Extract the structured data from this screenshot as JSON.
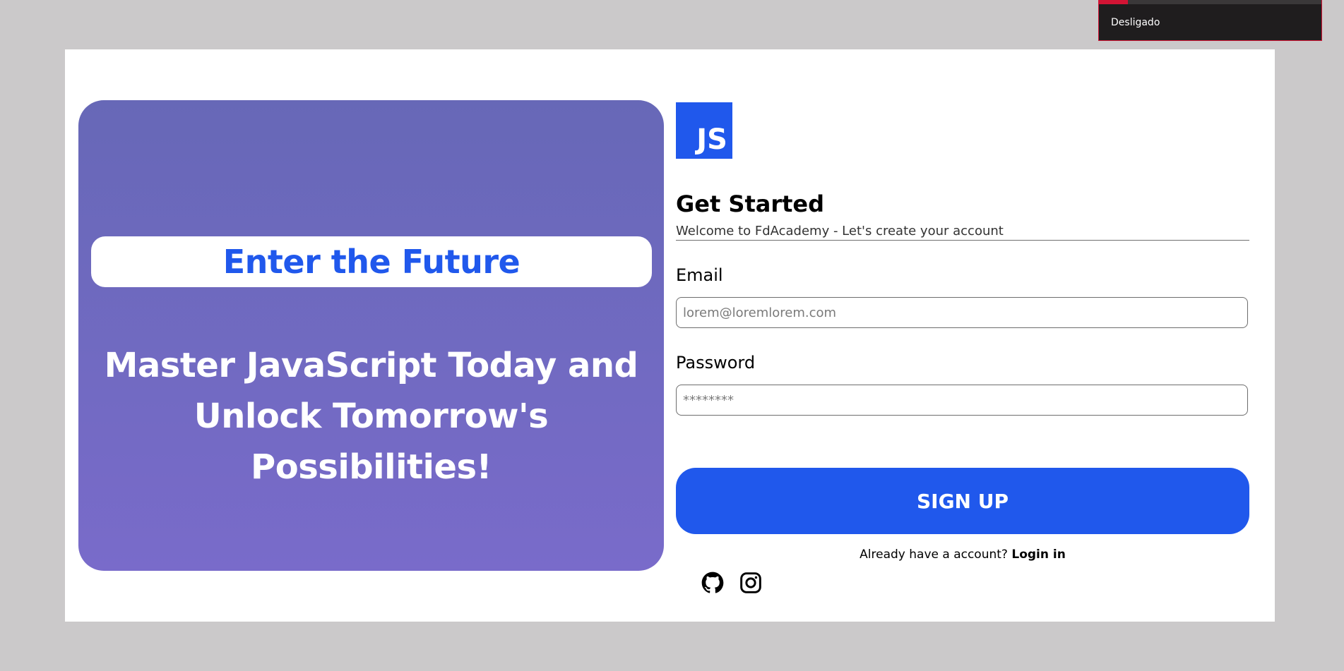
{
  "colors": {
    "backdrop": "#cbc9ca",
    "accent": "#2058ec",
    "hero_top": "#6768b7",
    "hero_bottom": "#796bca",
    "notification_bg": "#1f1d1e",
    "notification_accent": "#d21434"
  },
  "notification": {
    "text": "Desligado",
    "progress": 0.13
  },
  "hero": {
    "pill_text": "Enter the Future",
    "headline_line1": "Master JavaScript Today and",
    "headline_line2": "Unlock Tomorrow's Possibilities!"
  },
  "logo": {
    "text": "JS"
  },
  "form": {
    "title": "Get Started",
    "subtitle": "Welcome to FdAcademy - Let's create your account",
    "email_label": "Email",
    "email_placeholder": "lorem@loremlorem.com",
    "email_value": "",
    "password_label": "Password",
    "password_placeholder": "********",
    "password_value": "",
    "submit_label": "SIGN UP",
    "login_prompt": "Already have a account?",
    "login_link": "Login in"
  },
  "socials": [
    {
      "icon": "github-icon"
    },
    {
      "icon": "instagram-icon"
    }
  ]
}
